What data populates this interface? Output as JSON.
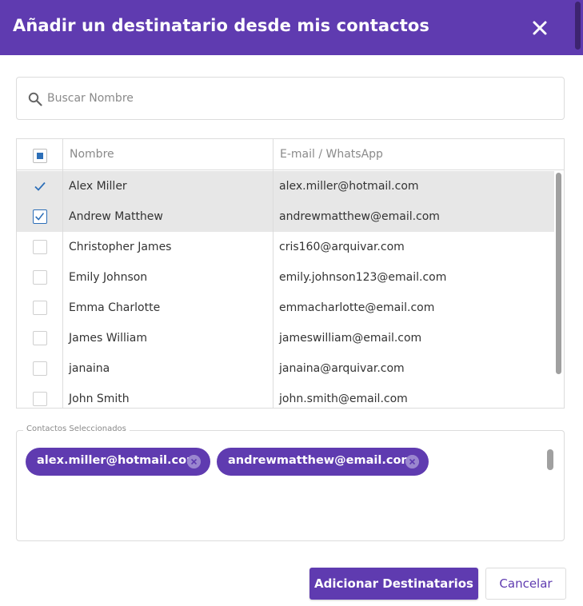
{
  "dialog": {
    "title": "Añadir un destinatario desde mis contactos",
    "close_icon": "close-icon",
    "accent_color": "#5f3bb0"
  },
  "search": {
    "placeholder": "Buscar Nombre",
    "value": "",
    "icon": "search-icon"
  },
  "table": {
    "columns": [
      "Nombre",
      "E-mail / WhatsApp"
    ],
    "header_checkbox_state": "indeterminate",
    "rows": [
      {
        "name": "Alex Miller",
        "email": "alex.miller@hotmail.com",
        "checked": true
      },
      {
        "name": "Andrew Matthew",
        "email": "andrewmatthew@email.com",
        "checked": true
      },
      {
        "name": "Christopher James",
        "email": "cris160@arquivar.com",
        "checked": false
      },
      {
        "name": "Emily Johnson",
        "email": "emily.johnson123@email.com",
        "checked": false
      },
      {
        "name": "Emma Charlotte",
        "email": "emmacharlotte@email.com",
        "checked": false
      },
      {
        "name": "James William",
        "email": "jameswilliam@email.com",
        "checked": false
      },
      {
        "name": "janaina",
        "email": "janaina@arquivar.com",
        "checked": false
      },
      {
        "name": "John Smith",
        "email": "john.smith@email.com",
        "checked": false
      }
    ]
  },
  "selected": {
    "legend": "Contactos Seleccionados",
    "chips": [
      "alex.miller@hotmail.com",
      "andrewmatthew@email.com"
    ]
  },
  "actions": {
    "primary_label": "Adicionar Destinatarios",
    "secondary_label": "Cancelar"
  }
}
